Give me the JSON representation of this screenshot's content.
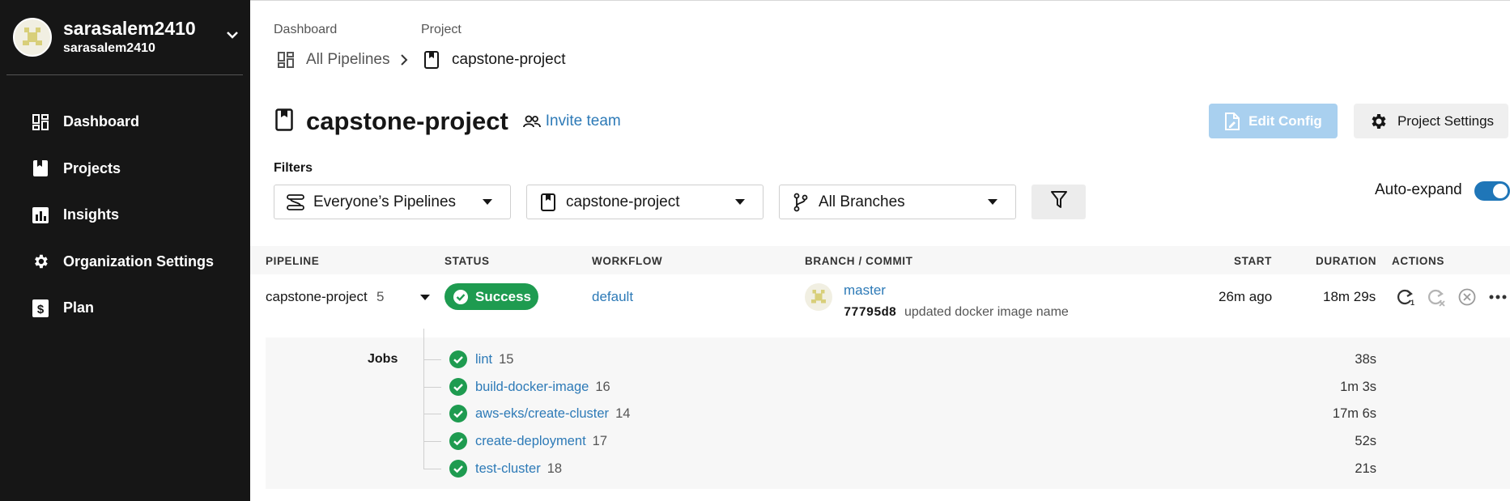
{
  "user": {
    "name": "sarasalem2410",
    "org": "sarasalem2410"
  },
  "sidebar": {
    "items": [
      {
        "label": "Dashboard",
        "icon": "dashboard-icon"
      },
      {
        "label": "Projects",
        "icon": "projects-icon"
      },
      {
        "label": "Insights",
        "icon": "insights-icon"
      },
      {
        "label": "Organization Settings",
        "icon": "gear-icon"
      },
      {
        "label": "Plan",
        "icon": "plan-icon"
      }
    ]
  },
  "breadcrumb": {
    "dashboard_label": "Dashboard",
    "dashboard_value": "All Pipelines",
    "project_label": "Project",
    "project_value": "capstone-project"
  },
  "header": {
    "title": "capstone-project",
    "invite_label": "Invite team",
    "edit_config_label": "Edit Config",
    "project_settings_label": "Project Settings"
  },
  "filters": {
    "label": "Filters",
    "pipelines": "Everyone’s Pipelines",
    "project": "capstone-project",
    "branches": "All Branches",
    "autoexpand_label": "Auto-expand",
    "autoexpand_on": true
  },
  "table": {
    "headers": {
      "pipeline": "PIPELINE",
      "status": "STATUS",
      "workflow": "WORKFLOW",
      "branch_commit": "BRANCH / COMMIT",
      "start": "START",
      "duration": "DURATION",
      "actions": "ACTIONS"
    },
    "row": {
      "pipeline": "capstone-project",
      "number": "5",
      "status": "Success",
      "workflow": "default",
      "branch": "master",
      "commit_hash": "77795d8",
      "commit_message": "updated docker image name",
      "start": "26m ago",
      "duration": "18m 29s"
    }
  },
  "jobs": {
    "label": "Jobs",
    "items": [
      {
        "name": "lint",
        "number": "15",
        "duration": "38s"
      },
      {
        "name": "build-docker-image",
        "number": "16",
        "duration": "1m 3s"
      },
      {
        "name": "aws-eks/create-cluster",
        "number": "14",
        "duration": "17m 6s"
      },
      {
        "name": "create-deployment",
        "number": "17",
        "duration": "52s"
      },
      {
        "name": "test-cluster",
        "number": "18",
        "duration": "21s"
      }
    ]
  },
  "colors": {
    "sidebar_bg": "#161616",
    "link": "#2d7ab7",
    "success": "#1e9b50",
    "edit_config_bg": "#a9d0ef",
    "toggle": "#1f76b8"
  }
}
